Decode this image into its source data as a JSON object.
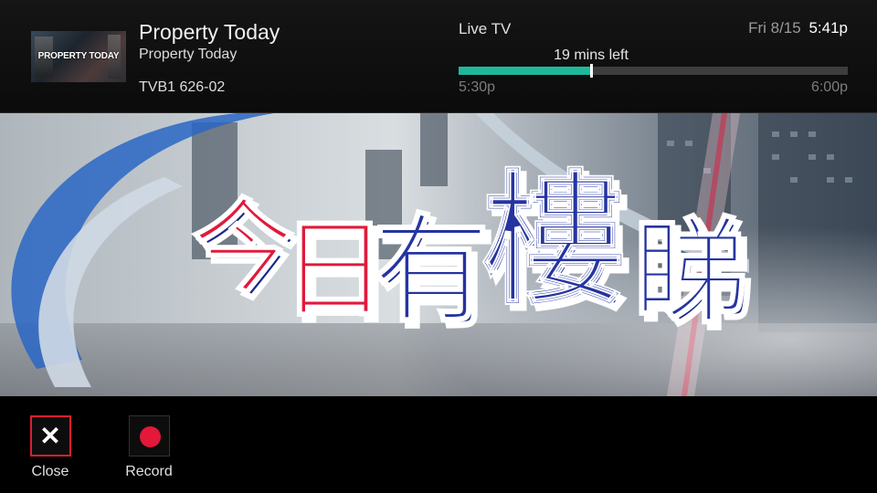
{
  "program": {
    "thumbnail_text": "PROPERTY TODAY",
    "title": "Property Today",
    "episode": "Property Today",
    "channel_info": "TVB1 626-02"
  },
  "live": {
    "label": "Live TV",
    "date": "Fri 8/15",
    "time": "5:41p",
    "remaining": "19 mins left",
    "start_time": "5:30p",
    "end_time": "6:00p",
    "progress_percent": 34
  },
  "video": {
    "title_characters": [
      "今",
      "日",
      "有",
      "樓",
      "睇"
    ]
  },
  "actions": [
    {
      "label": "Close",
      "icon": "close-icon",
      "selected": true
    },
    {
      "label": "Record",
      "icon": "record-icon",
      "selected": false
    }
  ],
  "colors": {
    "progress_fill": "#1fb89a",
    "selected_border": "#d9202f",
    "record_red": "#e3183a",
    "title_red": "#e01a3c",
    "title_blue": "#1a2a8c"
  }
}
